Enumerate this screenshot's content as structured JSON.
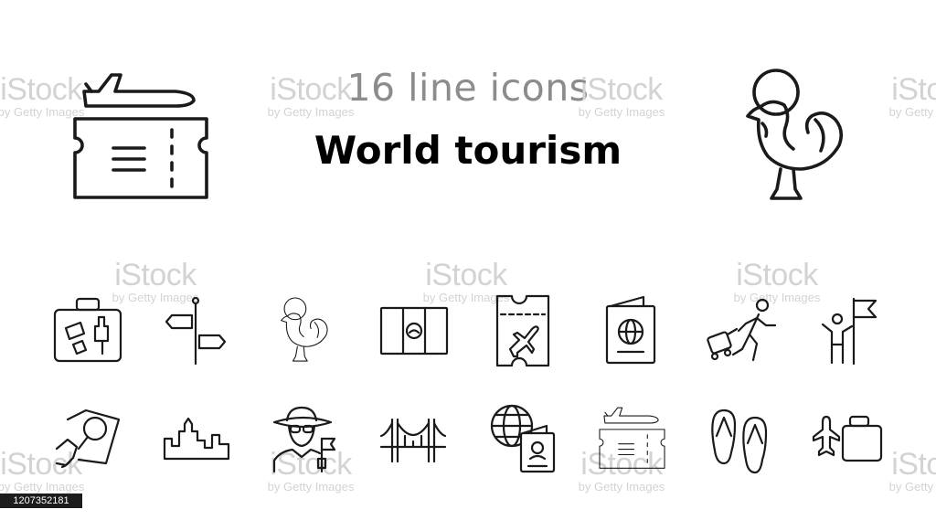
{
  "header": {
    "subtitle": "16 line icons",
    "title": "World tourism"
  },
  "watermark": {
    "brand": "iStock",
    "credit": "by Getty Images"
  },
  "stock_id": "1207352181",
  "hero_icons": [
    "flight-ticket-icon",
    "portugal-rooster-icon"
  ],
  "icon_grid": [
    [
      "luggage-icon",
      "signpost-icon",
      "rooster-icon",
      "passport-id-icon",
      "plane-ticket-icon",
      "passport-icon",
      "tourist-with-suitcase-icon",
      "man-with-flag-icon"
    ],
    [
      "map-search-icon",
      "city-skyline-icon",
      "tourist-portrait-icon",
      "bridge-icon",
      "globe-passport-icon",
      "flight-ticket-icon",
      "flip-flops-icon",
      "airplane-suitcase-icon"
    ]
  ]
}
